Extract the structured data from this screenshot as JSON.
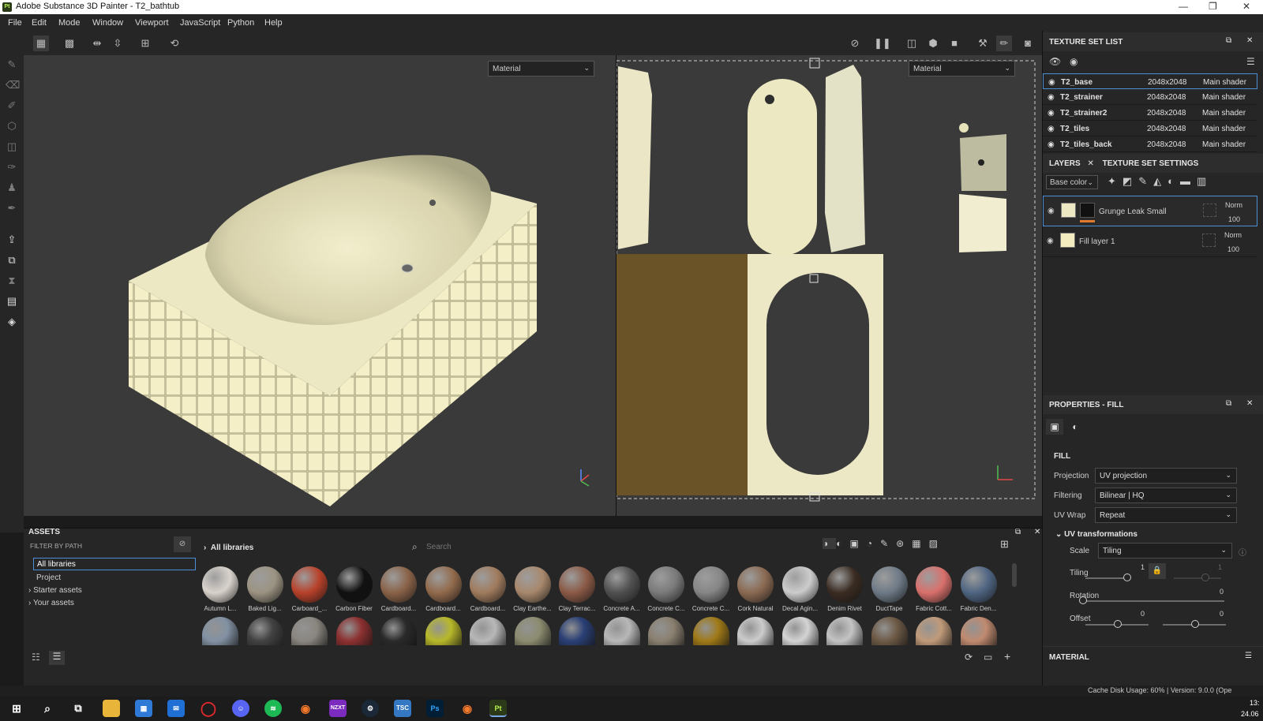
{
  "app": {
    "title": "Adobe Substance 3D Painter - T2_bathtub",
    "logo_text": "Pt"
  },
  "menu": [
    "File",
    "Edit",
    "Mode",
    "Window",
    "Viewport",
    "JavaScript",
    "Python",
    "Help"
  ],
  "viewport": {
    "left_mode": "Material",
    "right_mode": "Material"
  },
  "texture_set_list": {
    "title": "TEXTURE SET LIST",
    "rows": [
      {
        "name": "T2_base",
        "res": "2048x2048",
        "shader": "Main shader"
      },
      {
        "name": "T2_strainer",
        "res": "2048x2048",
        "shader": "Main shader"
      },
      {
        "name": "T2_strainer2",
        "res": "2048x2048",
        "shader": "Main shader"
      },
      {
        "name": "T2_tiles",
        "res": "2048x2048",
        "shader": "Main shader"
      },
      {
        "name": "T2_tiles_back",
        "res": "2048x2048",
        "shader": "Main shader"
      }
    ]
  },
  "layers": {
    "tab1": "LAYERS",
    "tab2": "TEXTURE SET SETTINGS",
    "channel": "Base color",
    "rows": [
      {
        "name": "Grunge Leak Small",
        "blend": "Norm",
        "opacity": "100"
      },
      {
        "name": "Fill layer 1",
        "blend": "Norm",
        "opacity": "100"
      }
    ]
  },
  "properties": {
    "title": "PROPERTIES - FILL",
    "section": "FILL",
    "projection": {
      "label": "Projection",
      "value": "UV projection"
    },
    "filtering": {
      "label": "Filtering",
      "value": "Bilinear | HQ"
    },
    "uvwrap": {
      "label": "UV Wrap",
      "value": "Repeat"
    },
    "uvtrans": "UV transformations",
    "scale": {
      "label": "Scale",
      "value": "Tiling"
    },
    "tiling": {
      "label": "Tiling",
      "v1": "1",
      "v2": "1"
    },
    "rotation": {
      "label": "Rotation",
      "v": "0"
    },
    "offset": {
      "label": "Offset",
      "v1": "0",
      "v2": "0"
    },
    "material": "MATERIAL"
  },
  "assets": {
    "title": "ASSETS",
    "filter": "FILTER BY PATH",
    "tree": [
      "All libraries",
      "Project",
      "Starter assets",
      "Your assets"
    ],
    "breadcrumb": "All libraries",
    "search_placeholder": "Search",
    "row1": [
      {
        "name": "Autumn L...",
        "color": "#d9d3cc"
      },
      {
        "name": "Baked Lig...",
        "color": "#9c9382"
      },
      {
        "name": "Carboard_...",
        "color": "#b8412a"
      },
      {
        "name": "Carbon Fiber",
        "color": "#111111"
      },
      {
        "name": "Cardboard...",
        "color": "#8a6248"
      },
      {
        "name": "Cardboard...",
        "color": "#926a4c"
      },
      {
        "name": "Cardboard...",
        "color": "#a07b5d"
      },
      {
        "name": "Clay Earthe...",
        "color": "#a8886c"
      },
      {
        "name": "Clay Terrac...",
        "color": "#8b5a46"
      },
      {
        "name": "Concrete A...",
        "color": "#505050"
      },
      {
        "name": "Concrete C...",
        "color": "#7a7a7a"
      },
      {
        "name": "Concrete C...",
        "color": "#868686"
      },
      {
        "name": "Cork Natural",
        "color": "#8b6a52"
      },
      {
        "name": "Decal Agin...",
        "color": "#cccccc"
      },
      {
        "name": "Denim Rivet",
        "color": "#3a2c22"
      },
      {
        "name": "DuctTape",
        "color": "#6e7a87"
      },
      {
        "name": "Fabric Cott...",
        "color": "#d9706c"
      },
      {
        "name": "Fabric Den...",
        "color": "#4f6582"
      }
    ],
    "row2": [
      "#8291a3",
      "#424242",
      "#8a8680",
      "#8c3030",
      "#2a2a2a",
      "#b8b82a",
      "#b8b8b8",
      "#8c8c70",
      "#2a3f75",
      "#b8b8b8",
      "#8a8070",
      "#a07a18",
      "#cccccc",
      "#d4d4d4",
      "#c4c4c4",
      "#6e5a46",
      "#c09a7a",
      "#c08a70"
    ]
  },
  "status": "Cache Disk Usage:   60% | Version: 9.0.0 (Ope",
  "clock": {
    "time": "13:",
    "date": "24.06"
  }
}
